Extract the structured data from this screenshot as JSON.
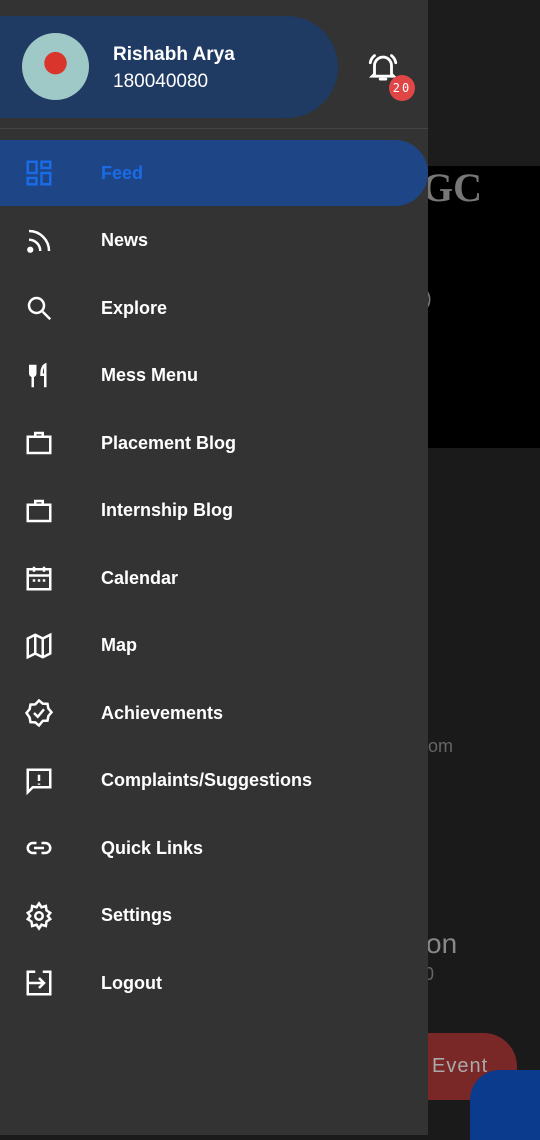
{
  "user": {
    "name": "Rishabh Arya",
    "roll": "180040080"
  },
  "notifications": {
    "count": "20",
    "icon": "bell-ring-icon",
    "badge_color": "#e04646"
  },
  "accent": "#1a6be6",
  "menu": [
    {
      "label": "Feed",
      "icon": "dashboard-icon",
      "active": true
    },
    {
      "label": "News",
      "icon": "rss-icon"
    },
    {
      "label": "Explore",
      "icon": "search-icon"
    },
    {
      "label": "Mess Menu",
      "icon": "restaurant-icon"
    },
    {
      "label": "Placement Blog",
      "icon": "briefcase-icon"
    },
    {
      "label": "Internship Blog",
      "icon": "briefcase-icon"
    },
    {
      "label": "Calendar",
      "icon": "calendar-icon"
    },
    {
      "label": "Map",
      "icon": "map-icon"
    },
    {
      "label": "Achievements",
      "icon": "verified-icon"
    },
    {
      "label": "Complaints/Suggestions",
      "icon": "feedback-icon"
    },
    {
      "label": "Quick Links",
      "icon": "link-icon"
    },
    {
      "label": "Settings",
      "icon": "gear-icon"
    },
    {
      "label": "Logout",
      "icon": "logout-icon"
    }
  ],
  "background": {
    "fragments": [
      "GC",
      ")",
      "om",
      "tition",
      "0"
    ],
    "event_button": "Event"
  }
}
